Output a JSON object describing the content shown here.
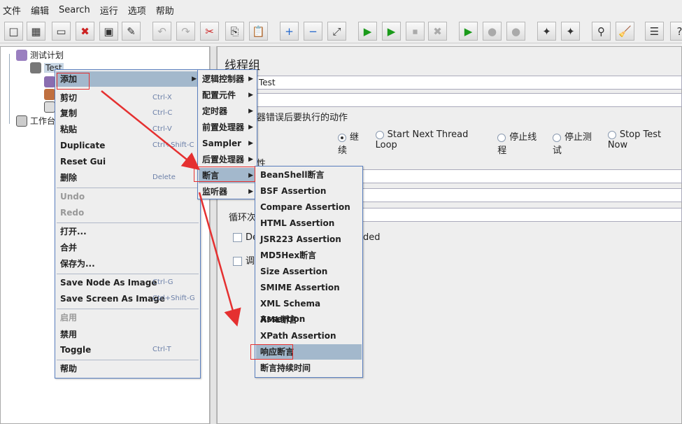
{
  "menubar": [
    "文件",
    "编辑",
    "Search",
    "运行",
    "选项",
    "帮助"
  ],
  "toolbar_icons": [
    "new-icon",
    "templates-icon",
    "open-icon",
    "close-icon",
    "save-icon",
    "save-as-icon",
    "undo-icon",
    "redo-icon",
    "cut-icon",
    "copy-icon",
    "paste-icon",
    "expand-icon",
    "collapse-icon",
    "toggle-icon",
    "start-icon",
    "start-no-pause-icon",
    "stop-icon",
    "shutdown-icon",
    "remote-start-icon",
    "remote-stop-icon",
    "remote-exit-icon",
    "clear-icon",
    "clear-all-icon",
    "search-icon",
    "reset-search-icon",
    "function-helper-icon",
    "help-icon"
  ],
  "tree": {
    "plan": "测试计划",
    "thread_group": "Test",
    "workbench": "工作台"
  },
  "right": {
    "title": "线程组",
    "name_value": "Test",
    "error_section": "器错误后要执行的动作",
    "radios": [
      "继续",
      "Start Next Thread Loop",
      "停止线程",
      "停止测试",
      "Stop Test Now"
    ],
    "selected_radio": "继续",
    "props_section": "性",
    "loop_label": "循环次",
    "check1": "De",
    "check1_tail": "eded",
    "check2": "调"
  },
  "context_menu": {
    "items": [
      {
        "label": "添加",
        "submenu": true
      },
      {
        "label": "剪切",
        "shortcut": "Ctrl-X"
      },
      {
        "label": "复制",
        "shortcut": "Ctrl-C"
      },
      {
        "label": "粘贴",
        "shortcut": "Ctrl-V"
      },
      {
        "label": "Duplicate",
        "shortcut": "Ctrl+Shift-C"
      },
      {
        "label": "Reset Gui"
      },
      {
        "label": "删除",
        "shortcut": "Delete"
      },
      {
        "label": "Undo",
        "disabled": true
      },
      {
        "label": "Redo",
        "disabled": true
      },
      {
        "label": "打开..."
      },
      {
        "label": "合并"
      },
      {
        "label": "保存为..."
      },
      {
        "label": "Save Node As Image",
        "shortcut": "Ctrl-G"
      },
      {
        "label": "Save Screen As Image",
        "shortcut": "Ctrl+Shift-G"
      },
      {
        "label": "启用",
        "disabled": true
      },
      {
        "label": "禁用"
      },
      {
        "label": "Toggle",
        "shortcut": "Ctrl-T"
      },
      {
        "label": "帮助"
      }
    ]
  },
  "add_submenu": [
    "逻辑控制器",
    "配置元件",
    "定时器",
    "前置处理器",
    "Sampler",
    "后置处理器",
    "断言",
    "监听器"
  ],
  "assertion_submenu": [
    "BeanShell断言",
    "BSF Assertion",
    "Compare Assertion",
    "HTML Assertion",
    "JSR223 Assertion",
    "MD5Hex断言",
    "Size Assertion",
    "SMIME Assertion",
    "XML Schema Assertion",
    "XML断言",
    "XPath Assertion",
    "响应断言",
    "断言持续时间"
  ],
  "colors": {
    "selection": "#a3b8cc",
    "annotation": "#e53030",
    "menu_border": "#5a7fbf"
  }
}
